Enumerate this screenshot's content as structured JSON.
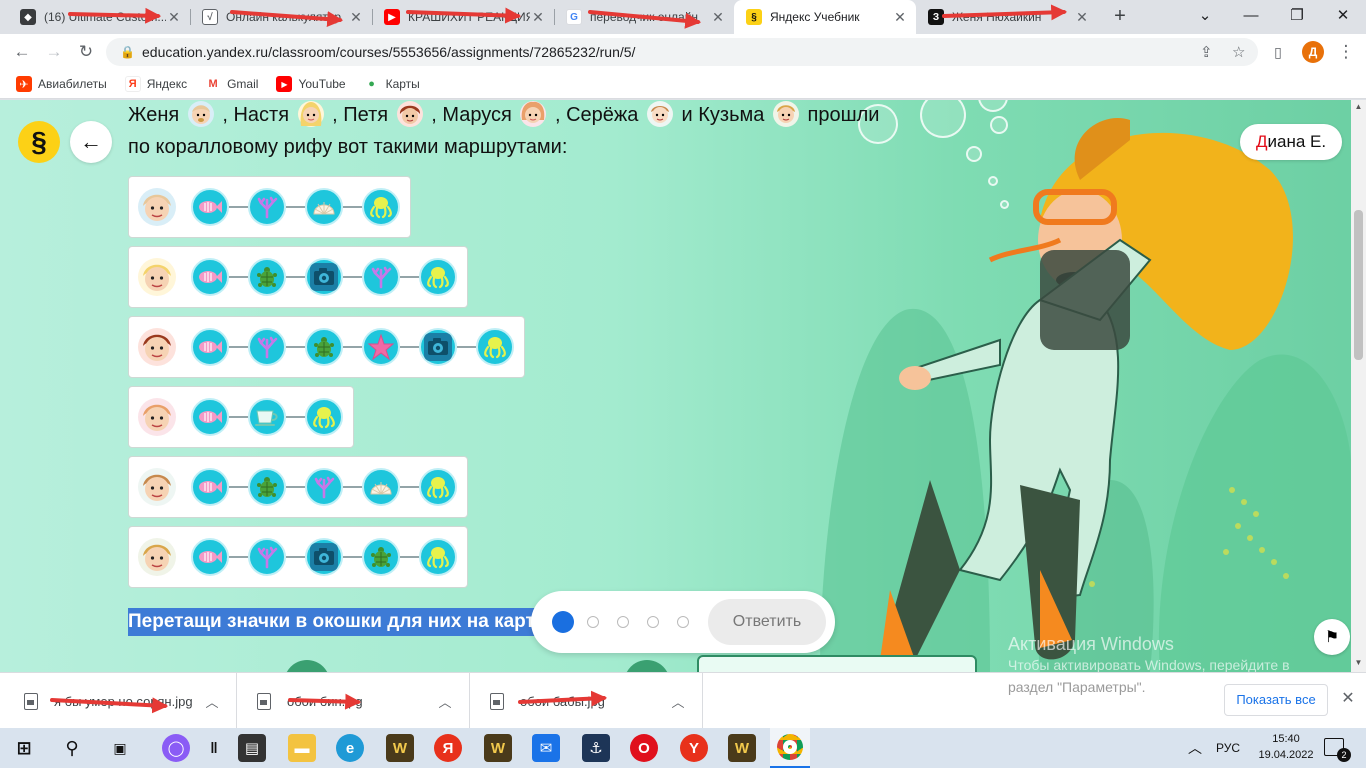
{
  "browser": {
    "tabs": [
      {
        "title": "(16) Ultimate Custom...",
        "favicon": "roblox-icon",
        "color": "#393b3d",
        "active": false
      },
      {
        "title": "Онлайн калькулятор",
        "favicon": "calculator-icon",
        "color": "#5f6368",
        "active": false
      },
      {
        "title": "КРАШИХИТ РЕАКЦИЯ",
        "favicon": "youtube-icon",
        "color": "#ff0000",
        "active": false
      },
      {
        "title": "переводчик онлайн",
        "favicon": "google-icon",
        "color": "#4285f4",
        "active": false
      },
      {
        "title": "Яндекс Учебник",
        "favicon": "yandex-uchebnik-icon",
        "color": "#fcd116",
        "active": true
      },
      {
        "title": "Женя Нюхайкин",
        "favicon": "z-icon",
        "color": "#111111",
        "active": false
      }
    ],
    "url": "education.yandex.ru/classroom/courses/5553656/assignments/72865232/run/5/",
    "profile_letter": "Д",
    "bookmarks": [
      {
        "label": "Авиабилеты",
        "icon": "aviasales-icon",
        "color": "#ff3b00"
      },
      {
        "label": "Яндекс",
        "icon": "yandex-icon",
        "color": "#fc3f1d"
      },
      {
        "label": "Gmail",
        "icon": "gmail-icon",
        "color": "#ea4335"
      },
      {
        "label": "YouTube",
        "icon": "youtube-icon",
        "color": "#ff0000"
      },
      {
        "label": "Карты",
        "icon": "maps-pin-icon",
        "color": "#34a853"
      }
    ]
  },
  "lesson": {
    "user_first": "Д",
    "user_rest": "иана Е.",
    "task_text": {
      "n1": "Женя",
      "n2": ", Настя",
      "n3": ", Петя",
      "n4": ", Маруся",
      "n5": ", Серёжа",
      "n6": " и Кузьма",
      "tail": " прошли по коралловому рифу вот такими маршрутами:"
    },
    "routes": [
      {
        "person": "zhenya",
        "stops": [
          "fish",
          "coral",
          "shell",
          "octopus"
        ]
      },
      {
        "person": "nastya",
        "stops": [
          "fish",
          "turtle",
          "camera",
          "coral",
          "octopus"
        ]
      },
      {
        "person": "petya",
        "stops": [
          "fish",
          "coral",
          "turtle",
          "starfish",
          "camera",
          "octopus"
        ]
      },
      {
        "person": "marusya",
        "stops": [
          "fish",
          "cup",
          "octopus"
        ]
      },
      {
        "person": "seryozha",
        "stops": [
          "fish",
          "turtle",
          "coral",
          "shell",
          "octopus"
        ]
      },
      {
        "person": "kuzma",
        "stops": [
          "fish",
          "coral",
          "camera",
          "turtle",
          "octopus"
        ]
      }
    ],
    "instruction": "Перетащи значки в окошки для них на карт",
    "pager": {
      "total": 5,
      "current": 1
    },
    "answer_label": "Ответить",
    "colors": {
      "node": "#1ec6dc",
      "accent": "#1a6fe0",
      "highlight": "#3d7bd6",
      "logo": "#fcd116"
    }
  },
  "watermark": {
    "line1": "Активация Windows",
    "line2": "Чтобы активировать Windows, перейдите в",
    "line3": "раздел \"Параметры\"."
  },
  "downloads": {
    "items": [
      {
        "name": "я бы умер но сорян.jpg"
      },
      {
        "name": "обои бин.jpg"
      },
      {
        "name": "обои бабы.jpg"
      }
    ],
    "show_all": "Показать все"
  },
  "taskbar": {
    "lang": "РУС",
    "time": "15:40",
    "date": "19.04.2022",
    "notifications": "2"
  }
}
